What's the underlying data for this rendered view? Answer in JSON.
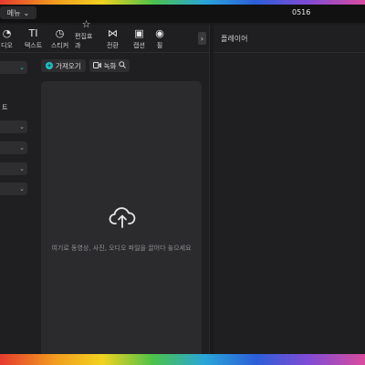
{
  "titlebar": {
    "menu_label": "메뉴",
    "project_name": "0516"
  },
  "toolbar": {
    "tools": [
      {
        "label": "디오",
        "icon": "audio-icon",
        "glyph": "◔"
      },
      {
        "label": "텍스트",
        "icon": "text-icon",
        "glyph": "TI"
      },
      {
        "label": "스티커",
        "icon": "sticker-icon",
        "glyph": "◷"
      },
      {
        "label": "편집효과",
        "icon": "effects-icon",
        "glyph": "☆"
      },
      {
        "label": "전환",
        "icon": "transition-icon",
        "glyph": "⋈"
      },
      {
        "label": "캡션",
        "icon": "caption-icon",
        "glyph": "▣"
      },
      {
        "label": "필",
        "icon": "filter-icon",
        "glyph": "◉"
      }
    ],
    "more_glyph": "›"
  },
  "sidebar": {
    "section_label": "트"
  },
  "media": {
    "import_label": "가져오기",
    "record_label": "녹화",
    "drop_text": "여기로 동영상, 사진, 오디오 파일을 끌어다 놓으세요"
  },
  "player": {
    "title": "플레이어"
  },
  "colors": {
    "accent": "#1fc6c6",
    "panel": "#1f1f21",
    "dropzone": "#2b2b2e"
  }
}
